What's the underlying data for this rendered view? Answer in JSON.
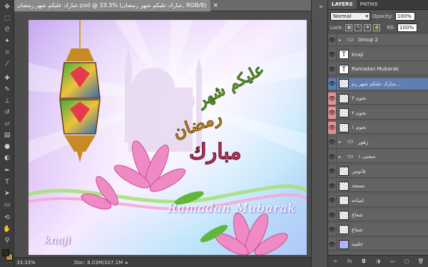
{
  "document": {
    "title": "عبارك عليكم شهر رمضان.psd @ 33.3% (عبارك عليكم شهر رمضان, RGB/8)",
    "canvas_text": {
      "ramadan_mubarak": "Ramadan Mubarak",
      "knaji": "knaji"
    }
  },
  "status": {
    "zoom": "33.33%",
    "doc_size": "Doc: 8.03M/107.1M"
  },
  "panel": {
    "tabs": [
      "LAYERS",
      "PATHS"
    ],
    "blend_mode": "Normal",
    "opacity_label": "Opacity:",
    "opacity": "100%",
    "lock_label": "Lock:",
    "fill_label": "Fill:",
    "fill": "100%"
  },
  "layers": [
    {
      "name": "Group 2",
      "kind": "group",
      "visible": true,
      "eye_color": "normal",
      "selected": false
    },
    {
      "name": "knaji",
      "kind": "text",
      "visible": true,
      "eye_color": "normal",
      "selected": false
    },
    {
      "name": "Ramadan Mubarak",
      "kind": "text",
      "visible": true,
      "eye_color": "normal",
      "selected": false
    },
    {
      "name": "مبارك عليكم شهر رم...",
      "kind": "layer",
      "visible": true,
      "eye_color": "normal",
      "selected": true
    },
    {
      "name": "نجوم ٣",
      "kind": "layer",
      "visible": true,
      "eye_color": "red",
      "selected": false
    },
    {
      "name": "نجوم ٢",
      "kind": "layer",
      "visible": true,
      "eye_color": "red",
      "selected": false
    },
    {
      "name": "نجوم ١",
      "kind": "layer",
      "visible": true,
      "eye_color": "red",
      "selected": false
    },
    {
      "name": "زهور",
      "kind": "group",
      "visible": true,
      "eye_color": "normal",
      "selected": false
    },
    {
      "name": "منحنى ١",
      "kind": "group",
      "visible": true,
      "eye_color": "normal",
      "selected": false
    },
    {
      "name": "فانوس",
      "kind": "layer",
      "visible": true,
      "eye_color": "normal",
      "selected": false
    },
    {
      "name": "مسجد",
      "kind": "layer",
      "visible": true,
      "eye_color": "normal",
      "selected": false
    },
    {
      "name": "اضاءه",
      "kind": "layer",
      "visible": true,
      "eye_color": "normal",
      "selected": false
    },
    {
      "name": "شعاع",
      "kind": "layer",
      "visible": true,
      "eye_color": "normal",
      "selected": false
    },
    {
      "name": "شعاع",
      "kind": "layer",
      "visible": true,
      "eye_color": "normal",
      "selected": false
    },
    {
      "name": "خلفية",
      "kind": "background",
      "visible": true,
      "eye_color": "normal",
      "selected": false
    }
  ],
  "colors": {
    "foreground": "#2b2b1f",
    "background": "#b8953c",
    "selection": "#5f7fb3",
    "stars_highlight": "#e69191"
  }
}
